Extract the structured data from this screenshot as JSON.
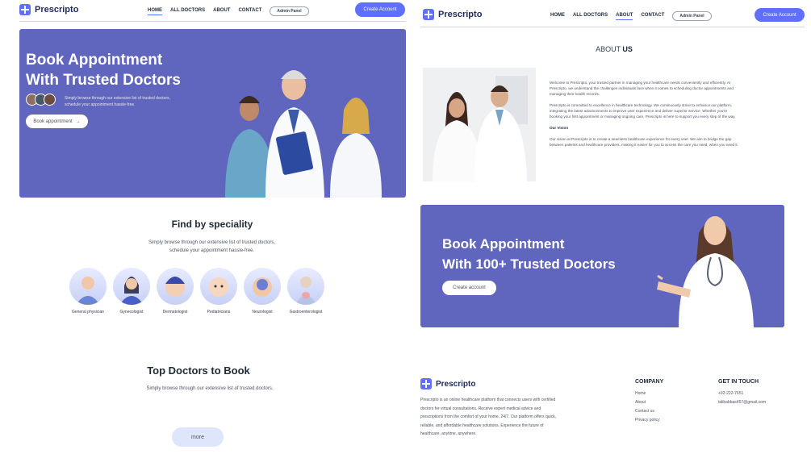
{
  "left_page": {
    "navbar": {
      "logo_text": "Prescripto",
      "links": [
        "HOME",
        "ALL DOCTORS",
        "ABOUT",
        "CONTACT"
      ],
      "active_link": "HOME",
      "admin_panel_label": "Admin Panel",
      "create_account_label": "Create Account"
    },
    "hero": {
      "title_line1": "Book Appointment",
      "title_line2": "With Trusted Doctors",
      "subtitle_line1": "Simply browse through our extensive list of trusted doctors,",
      "subtitle_line2": "schedule your appointment hassle-free.",
      "button_label": "Book appointment",
      "button_arrow": "→"
    },
    "speciality": {
      "title": "Find by speciality",
      "subtitle_line1": "Simply browse through our extensive list of trusted doctors,",
      "subtitle_line2": "schedule your appointment hassle-free.",
      "items": [
        {
          "label": "General physician"
        },
        {
          "label": "Gynecologist"
        },
        {
          "label": "Dermatologist"
        },
        {
          "label": "Pediatricians"
        },
        {
          "label": "Neurologist"
        },
        {
          "label": "Gastroenterologist"
        }
      ]
    },
    "top_doctors": {
      "title": "Top Doctors to Book",
      "subtitle": "Simply browse through our extensive list of trusted doctors.",
      "more_label": "more"
    }
  },
  "right_page": {
    "navbar": {
      "logo_text": "Prescripto",
      "links": [
        "HOME",
        "ALL DOCTORS",
        "ABOUT",
        "CONTACT"
      ],
      "active_link": "ABOUT",
      "admin_panel_label": "Admin Panel",
      "create_account_label": "Create Account"
    },
    "about": {
      "title_prefix": "ABOUT",
      "title_bold": "US",
      "para1": "Welcome to Prescripto, your trusted partner in managing your healthcare needs conveniently and efficiently. At Prescripto, we understand the challenges individuals face when it comes to scheduling doctor appointments and managing their health records.",
      "para2": "Prescripto is committed to excellence in healthcare technology. We continuously strive to enhance our platform, integrating the latest advancements to improve user experience and deliver superior service. Whether you're booking your first appointment or managing ongoing care, Prescripto is here to support you every step of the way.",
      "vision_title": "Our Vision",
      "vision_text": "Our vision at Prescripto is to create a seamless healthcare experience for every user. We aim to bridge the gap between patients and healthcare providers, making it easier for you to access the care you need, when you need it."
    },
    "cta": {
      "title_line1": "Book Appointment",
      "title_line2": "With 100+ Trusted Doctors",
      "button_label": "Create account"
    },
    "footer": {
      "logo_text": "Prescripto",
      "description": "Prescripto is an online healthcare platform that connects users with certified doctors for virtual consultations. Receive expert medical advice and prescriptions from the comfort of your home, 24/7. Our platform offers quick, reliable, and affordable healthcare solutions. Experience the future of healthcare, anytime, anywhere.",
      "company_title": "COMPANY",
      "company_links": [
        "Home",
        "About",
        "Contact us",
        "Privacy policy"
      ],
      "contact_title": "GET IN TOUCH",
      "phone": "+92-222-7651",
      "email": "talibabbas457@gmail.com"
    }
  },
  "colors": {
    "primary": "#5f6fff",
    "banner": "#6066bd",
    "text_dark": "#1f2937",
    "more_button_bg": "#dde6fb"
  }
}
